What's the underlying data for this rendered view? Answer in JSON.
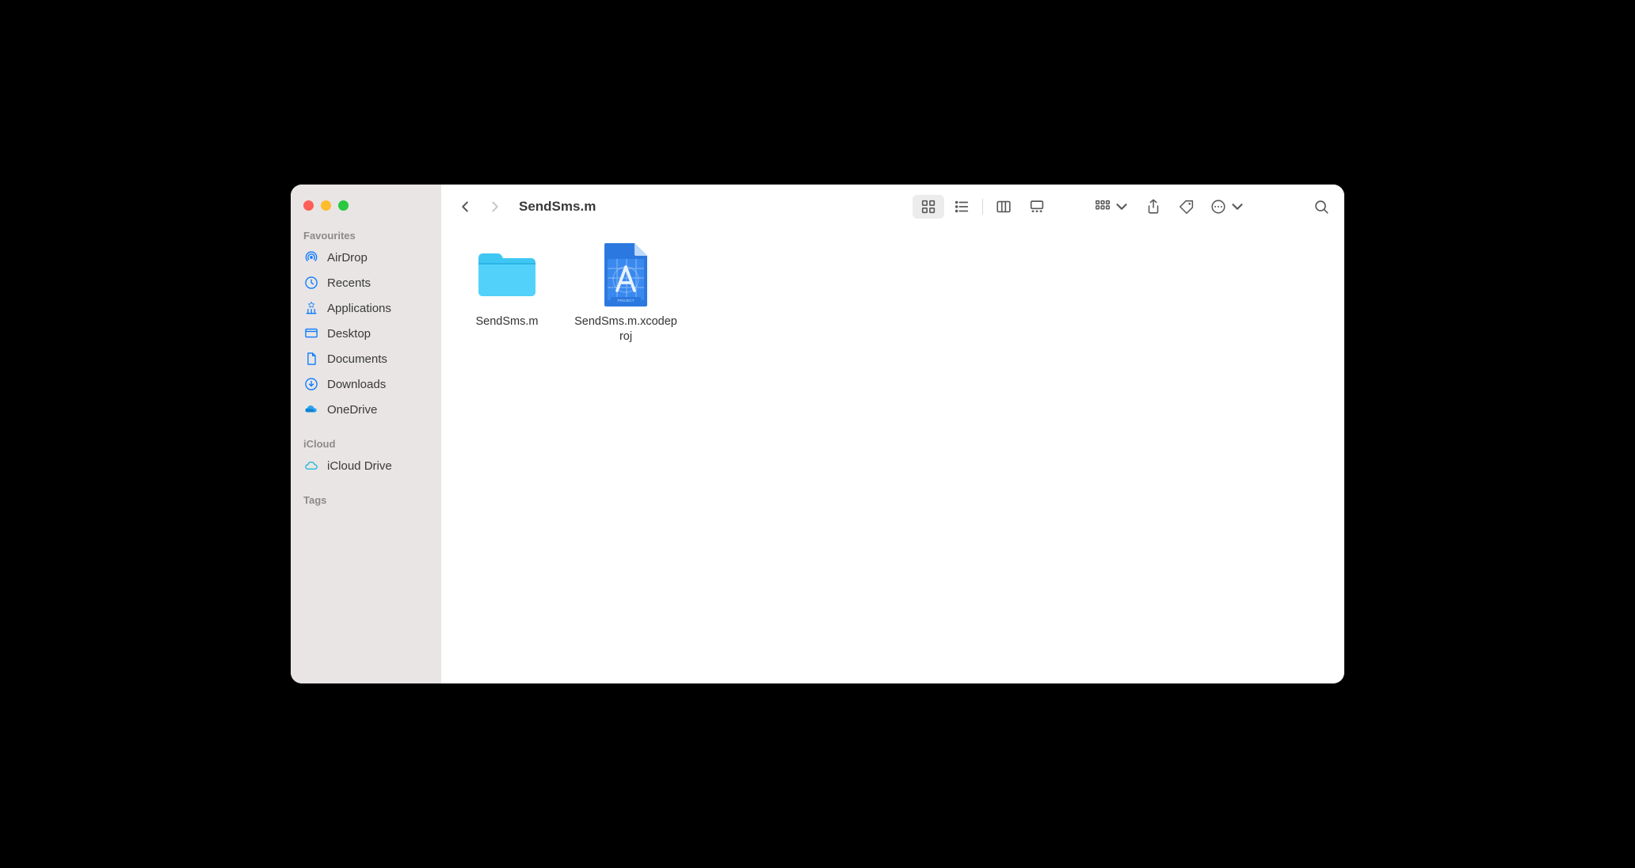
{
  "window": {
    "title": "SendSms.m"
  },
  "sidebar": {
    "sections": {
      "favourites": {
        "header": "Favourites",
        "items": [
          {
            "label": "AirDrop",
            "icon": "airdrop"
          },
          {
            "label": "Recents",
            "icon": "clock"
          },
          {
            "label": "Applications",
            "icon": "apps"
          },
          {
            "label": "Desktop",
            "icon": "desktop"
          },
          {
            "label": "Documents",
            "icon": "document"
          },
          {
            "label": "Downloads",
            "icon": "download"
          },
          {
            "label": "OneDrive",
            "icon": "onedrive"
          }
        ]
      },
      "icloud": {
        "header": "iCloud",
        "items": [
          {
            "label": "iCloud Drive",
            "icon": "cloud"
          }
        ]
      },
      "tags": {
        "header": "Tags"
      }
    }
  },
  "toolbar": {
    "view_mode": "icon"
  },
  "files": [
    {
      "name": "SendSms.m",
      "type": "folder"
    },
    {
      "name": "SendSms.m.xcodeproj",
      "type": "xcodeproj"
    }
  ]
}
